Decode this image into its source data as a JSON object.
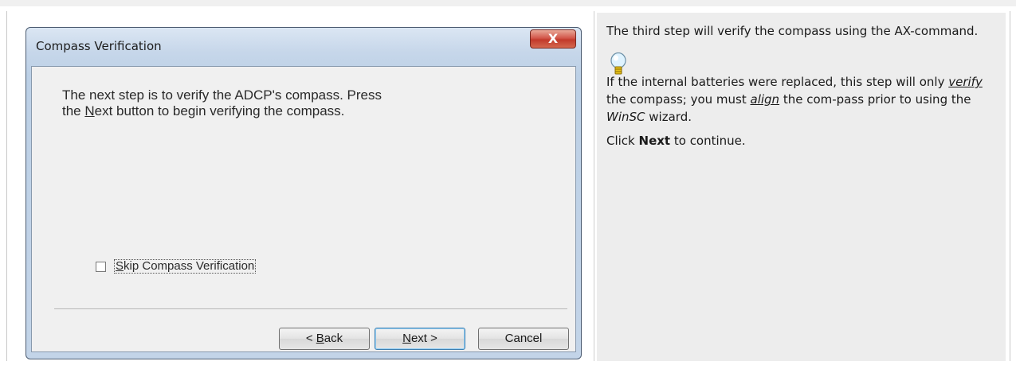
{
  "dialog": {
    "title": "Compass Verification",
    "close_glyph": "X",
    "message_parts": {
      "p1": "The next step is to verify the ADCP's compass.  Press the ",
      "next_underlined": "N",
      "p2": "ext button to begin verifying the compass."
    },
    "checkbox": {
      "checked": false,
      "label_mnemonic": "S",
      "label_rest": "kip Compass Verification"
    },
    "buttons": {
      "back_prefix": "< ",
      "back_mnemonic": "B",
      "back_rest": "ack",
      "next_mnemonic": "N",
      "next_rest": "ext >",
      "cancel": "Cancel"
    }
  },
  "help": {
    "para1": "The third step will verify the compass using the AX-command.",
    "tip_icon": "lightbulb-icon",
    "tip_a": " If the internal batteries were replaced, this step will only ",
    "tip_verify": "verify",
    "tip_b": " the compass; you must ",
    "tip_align": "align",
    "tip_c": " the com-pass prior to using the ",
    "tip_winsc": "WinSC",
    "tip_d": " wizard.",
    "click_a": "Click ",
    "click_next": "Next",
    "click_b": " to continue."
  },
  "colors": {
    "help_panel_bg": "#ededed",
    "close_button": "#c23a2b",
    "dialog_frame": "#c3d4e8"
  }
}
